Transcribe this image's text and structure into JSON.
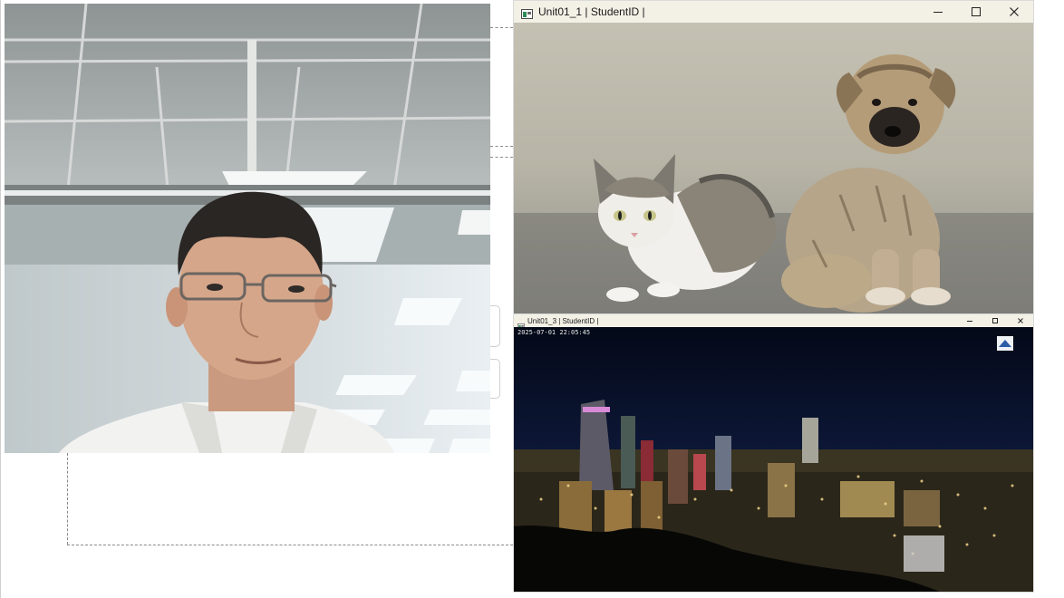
{
  "window1": {
    "title": "Unit01_1 | StudentID |",
    "icon": "app-window-icon",
    "buttons": [
      "minimize-icon",
      "maximize-icon",
      "close-icon"
    ]
  },
  "window3": {
    "title": "Unit01_3 | StudentID |",
    "icon": "app-window-icon",
    "buttons": [
      "minimize-icon",
      "maximize-icon",
      "close-icon"
    ],
    "timestamp": "2025-07-01 22:05:45"
  },
  "webcam": {
    "subject": "webcam feed"
  },
  "colors": {
    "titlebar": "#f3f0e6",
    "night_sky": "#050a1c",
    "dashed_line": "#8a8a8a"
  }
}
